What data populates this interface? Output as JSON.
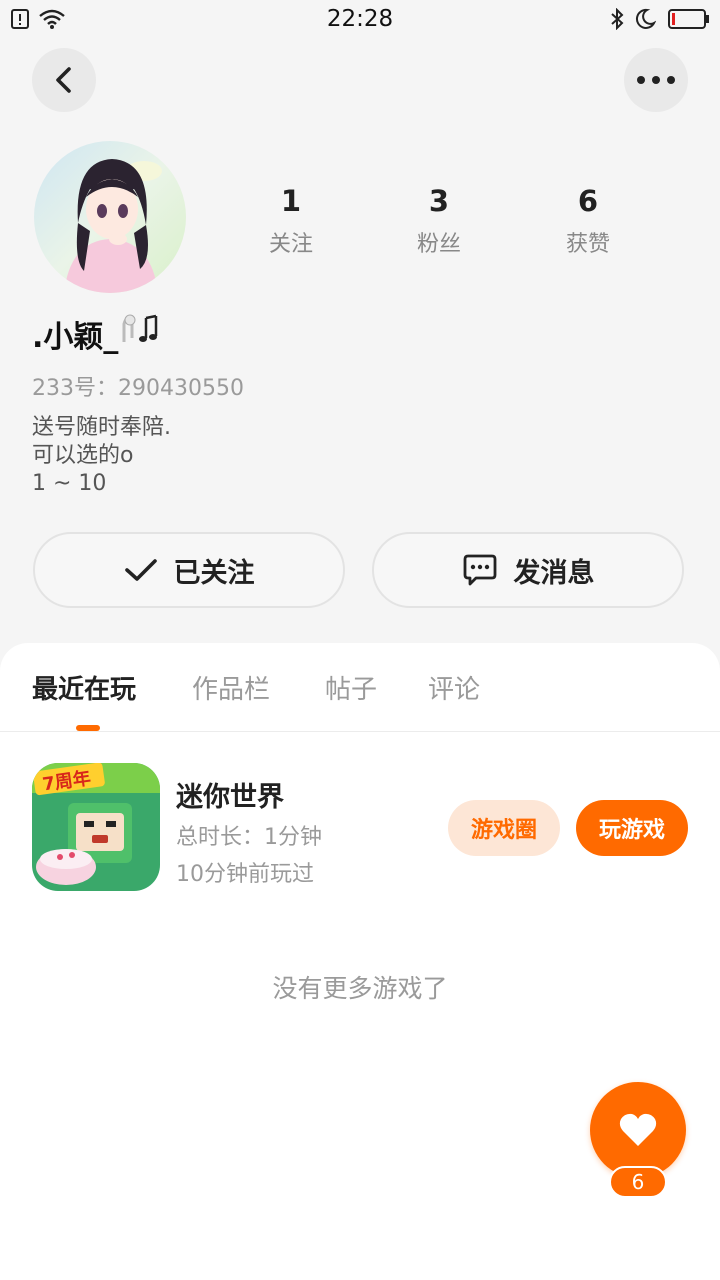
{
  "status_bar": {
    "time": "22:28",
    "battery_level": 0.1
  },
  "profile": {
    "username": ".小颖_",
    "id_line": "233号：290430550",
    "bio_lines": [
      "送号随时奉陪.",
      "可以选的o",
      "1 ~ 10"
    ],
    "stats": [
      {
        "value": "1",
        "label": "关注"
      },
      {
        "value": "3",
        "label": "粉丝"
      },
      {
        "value": "6",
        "label": "获赞"
      }
    ]
  },
  "actions": {
    "followed_label": "已关注",
    "message_label": "发消息"
  },
  "tabs": [
    {
      "label": "最近在玩",
      "active": true
    },
    {
      "label": "作品栏",
      "active": false
    },
    {
      "label": "帖子",
      "active": false
    },
    {
      "label": "评论",
      "active": false
    }
  ],
  "game": {
    "title": "迷你世界",
    "duration": "总时长：1分钟",
    "last_played": "10分钟前玩过",
    "circle_label": "游戏圈",
    "play_label": "玩游戏",
    "icon_badge": "7周年"
  },
  "empty_text": "没有更多游戏了",
  "like_fab": {
    "count": "6"
  },
  "colors": {
    "accent": "#ff6a00",
    "accent_light": "#fde6d6"
  }
}
